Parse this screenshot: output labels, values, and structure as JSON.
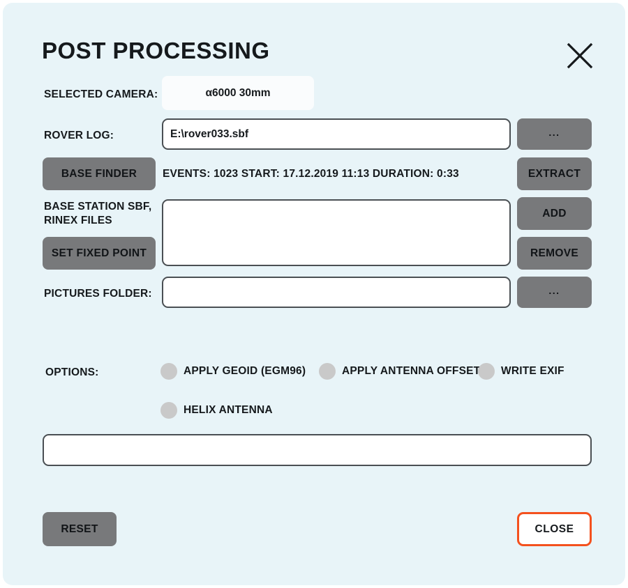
{
  "dialog": {
    "title": "POST PROCESSING",
    "close_icon": "close-x-icon",
    "accent_color": "#f4511e",
    "background_color": "#e8f4f8",
    "button_color": "#78797b"
  },
  "camera": {
    "label": "SELECTED CAMERA:",
    "value": "α6000 30mm"
  },
  "rover_log": {
    "label": "ROVER LOG:",
    "value": "E:\\rover033.sbf",
    "browse_label": "...",
    "info": "EVENTS: 1023  START: 17.12.2019 11:13  DURATION: 0:33",
    "base_finder_label": "BASE FINDER",
    "extract_label": "EXTRACT"
  },
  "base_station": {
    "label_line1": "BASE STATION SBF,",
    "label_line2": "RINEX FILES",
    "value": "",
    "set_fixed_point_label": "SET FIXED POINT",
    "add_label": "ADD",
    "remove_label": "REMOVE"
  },
  "pictures_folder": {
    "label": "PICTURES FOLDER:",
    "value": "",
    "browse_label": "..."
  },
  "options": {
    "label": "OPTIONS:",
    "items": [
      {
        "label": "APPLY GEOID (EGM96)",
        "checked": false
      },
      {
        "label": "APPLY ANTENNA OFFSET",
        "checked": false
      },
      {
        "label": "WRITE EXIF",
        "checked": false
      },
      {
        "label": "HELIX ANTENNA",
        "checked": false
      }
    ]
  },
  "status_bar": {
    "value": ""
  },
  "footer": {
    "reset_label": "RESET",
    "close_label": "CLOSE"
  }
}
